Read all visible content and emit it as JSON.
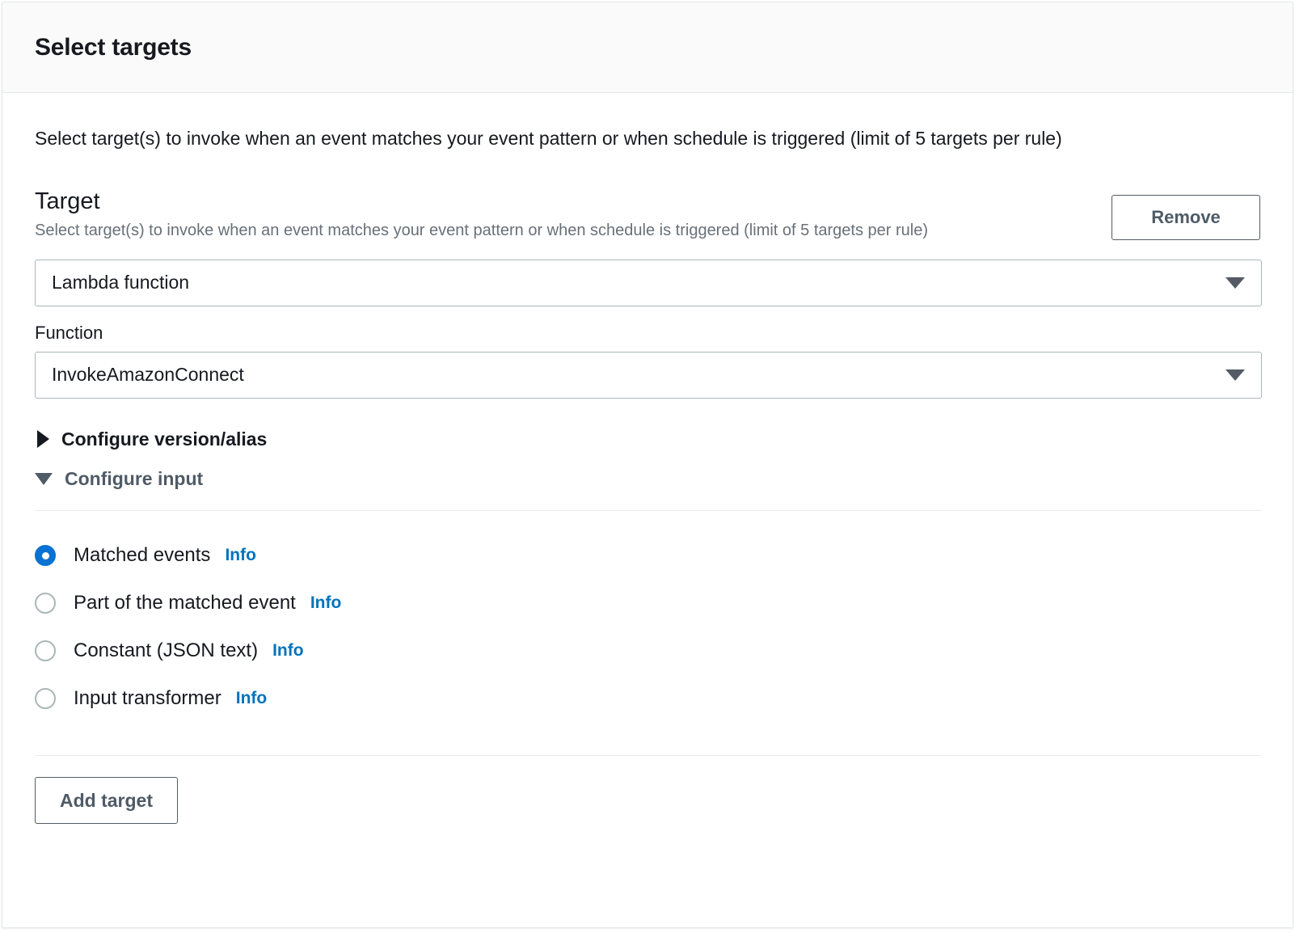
{
  "header": {
    "title": "Select targets"
  },
  "intro": {
    "text": "Select target(s) to invoke when an event matches your event pattern or when schedule is triggered (limit of 5 targets per rule)"
  },
  "target_section": {
    "title": "Target",
    "description": "Select target(s) to invoke when an event matches your event pattern or when schedule is triggered (limit of 5 targets per rule)",
    "remove_label": "Remove",
    "target_type": {
      "value": "Lambda function",
      "caret_icon": "chevron-down-icon"
    },
    "function": {
      "label": "Function",
      "value": "InvokeAmazonConnect",
      "caret_icon": "chevron-down-icon"
    },
    "expandos": [
      {
        "label": "Configure version/alias",
        "expanded": false,
        "icon": "triangle-right-icon"
      },
      {
        "label": "Configure input",
        "expanded": true,
        "icon": "triangle-down-icon"
      }
    ],
    "input_options": [
      {
        "label": "Matched events",
        "info_label": "Info",
        "selected": true
      },
      {
        "label": "Part of the matched event",
        "info_label": "Info",
        "selected": false
      },
      {
        "label": "Constant (JSON text)",
        "info_label": "Info",
        "selected": false
      },
      {
        "label": "Input transformer",
        "info_label": "Info",
        "selected": false
      }
    ]
  },
  "footer": {
    "add_target_label": "Add target"
  },
  "colors": {
    "accent_blue": "#0972d3",
    "link_blue": "#0073bb",
    "text_primary": "#16191f",
    "text_secondary": "#687078",
    "text_slate": "#4f5b66",
    "border": "#aab7b8",
    "divider": "#eaeded",
    "header_bg": "#fafafa"
  }
}
